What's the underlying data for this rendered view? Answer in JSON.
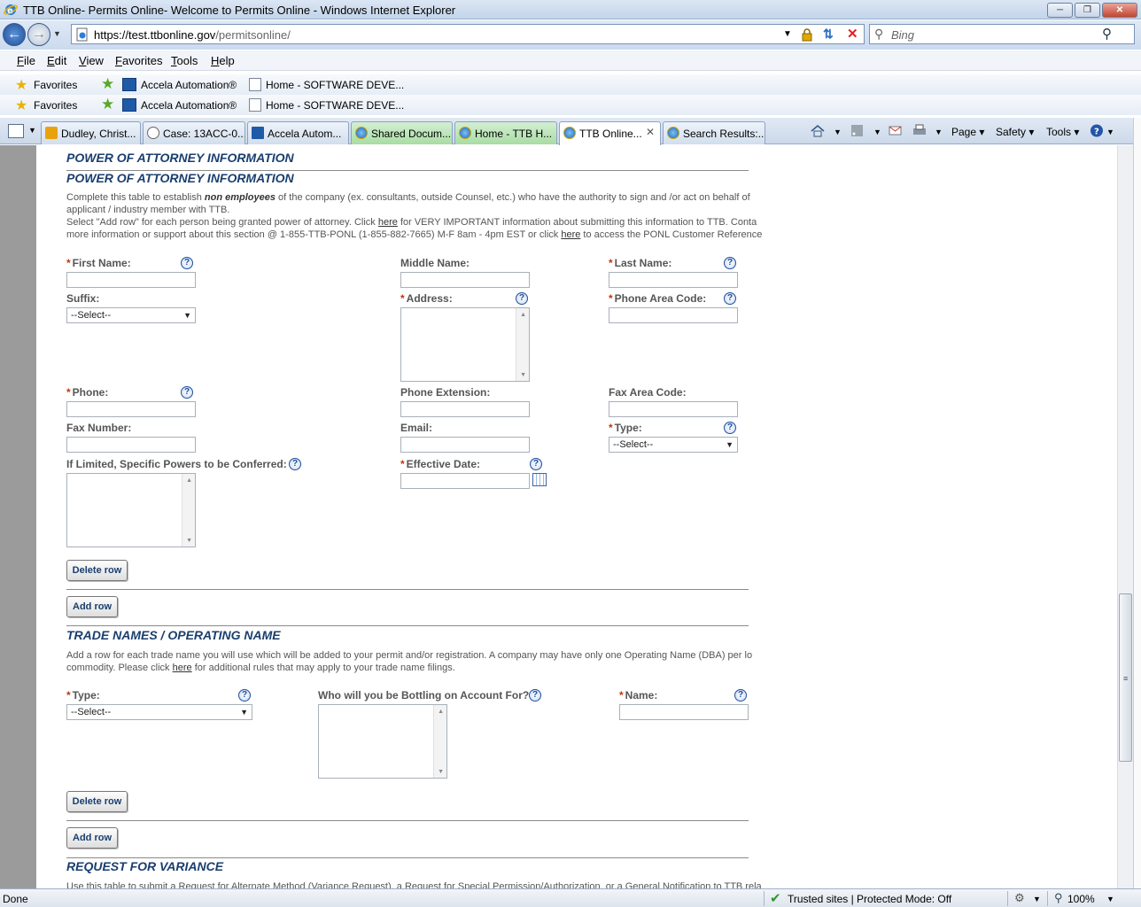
{
  "window": {
    "title": "TTB Online- Permits Online- Welcome to Permits Online - Windows Internet Explorer",
    "min_glyph": "─",
    "max_glyph": "❐",
    "close_glyph": "✕"
  },
  "address": {
    "url_main": "https://test.ttbonline.gov",
    "url_path": "/permitsonline/",
    "search_placeholder": "Bing"
  },
  "menu": [
    "File",
    "Edit",
    "View",
    "Favorites",
    "Tools",
    "Help"
  ],
  "favorites": {
    "label": "Favorites",
    "items": [
      "Accela Automation®",
      "Home - SOFTWARE DEVE..."
    ]
  },
  "tabs": [
    {
      "label": "Dudley, Christ...",
      "icon": "outlook-icon"
    },
    {
      "label": "Case: 13ACC-0...",
      "icon": "cloud-icon"
    },
    {
      "label": "Accela Autom...",
      "icon": "accela-icon"
    },
    {
      "label": "Shared Docum...",
      "icon": "ie-icon"
    },
    {
      "label": "Home - TTB H...",
      "icon": "ie-icon"
    },
    {
      "label": "TTB Online...",
      "icon": "ie-icon"
    },
    {
      "label": "Search Results:...",
      "icon": "ie-icon"
    }
  ],
  "commands": {
    "page": "Page",
    "safety": "Safety",
    "tools": "Tools"
  },
  "poa": {
    "header": "POWER OF ATTORNEY INFORMATION",
    "subheader": "POWER OF ATTORNEY INFORMATION",
    "desc1_a": "Complete this table to establish ",
    "desc1_b": "non employees",
    "desc1_c": " of the company (ex. consultants, outside Counsel, etc.) who have the authority to sign and /or act on behalf of",
    "desc2": "applicant / industry member with TTB.",
    "desc3_a": "Select \"Add row\" for each person being granted power of attorney. Click ",
    "desc3_link": "here",
    "desc3_b": " for VERY IMPORTANT information about submitting this information to TTB. Conta",
    "desc4_a": "more information or support about this section @ 1-855-TTB-PONL (1-855-882-7665) M-F 8am - 4pm EST or click ",
    "desc4_link": "here",
    "desc4_b": " to access the PONL Customer Reference",
    "fields": {
      "first_name": "First Name:",
      "middle_name": "Middle Name:",
      "last_name": "Last Name:",
      "suffix": "Suffix:",
      "address": "Address:",
      "phone_area": "Phone Area Code:",
      "phone": "Phone:",
      "phone_ext": "Phone Extension:",
      "fax_area": "Fax Area Code:",
      "fax_number": "Fax Number:",
      "email": "Email:",
      "type": "Type:",
      "limited_powers": "If Limited, Specific Powers to be Conferred:",
      "effective_date": "Effective Date:"
    },
    "select_default": "--Select--",
    "delete_row": "Delete row",
    "add_row": "Add row"
  },
  "trade": {
    "header": "TRADE NAMES / OPERATING NAME",
    "desc1": "Add a row for each trade name you will use which will be added to your permit and/or registration. A company may have only one Operating Name (DBA) per lo",
    "desc2_a": "commodity. Please click ",
    "desc2_link": "here",
    "desc2_b": " for additional rules that may apply to your trade name filings.",
    "fields": {
      "type": "Type:",
      "bottling": "Who will you be Bottling on Account For?:",
      "name": "Name:"
    },
    "select_default": "--Select--",
    "delete_row": "Delete row",
    "add_row": "Add row"
  },
  "variance": {
    "header": "REQUEST FOR VARIANCE",
    "desc": "Use this table to submit a Request for Alternate Method (Variance Request), a Request for Special Permission/Authorization, or a General Notification to TTB rela"
  },
  "status": {
    "left": "Done",
    "zone": "Trusted sites | Protected Mode: Off",
    "zoom": "100%"
  }
}
